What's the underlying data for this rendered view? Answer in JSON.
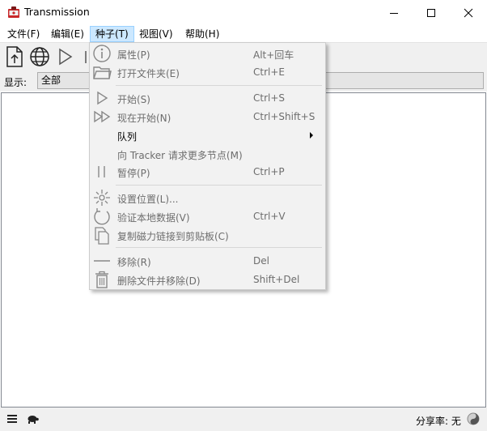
{
  "window": {
    "title": "Transmission",
    "icon": "transmission-app-icon",
    "controls": [
      "minimize-icon",
      "maximize-icon",
      "close-icon"
    ]
  },
  "menubar": {
    "items": [
      {
        "label": "文件(F)"
      },
      {
        "label": "编辑(E)"
      },
      {
        "label": "种子(T)",
        "active": true
      },
      {
        "label": "视图(V)"
      },
      {
        "label": "帮助(H)"
      }
    ]
  },
  "toolbar": {
    "buttons": [
      "open-file-icon",
      "globe-icon",
      "start-icon",
      "pause-icon"
    ]
  },
  "filter": {
    "label": "显示:",
    "selected": "全部"
  },
  "statusbar": {
    "ratio_label": "分享率: 无",
    "icons": [
      "menu-icon",
      "turtle-icon",
      "ratio-icon"
    ]
  },
  "torrent_menu": {
    "items": [
      {
        "label": "属性(P)",
        "accel": "Alt+回车",
        "icon": "info-icon",
        "enabled": false
      },
      {
        "label": "打开文件夹(E)",
        "accel": "Ctrl+E",
        "icon": "folder-icon",
        "enabled": false
      },
      {
        "label": "开始(S)",
        "accel": "Ctrl+S",
        "icon": "play-icon",
        "enabled": false
      },
      {
        "label": "现在开始(N)",
        "accel": "Ctrl+Shift+S",
        "icon": "fast-forward-icon",
        "enabled": false
      },
      {
        "label": "队列",
        "accel": "",
        "icon": "",
        "enabled": true,
        "submenu": true
      },
      {
        "label": "向 Tracker 请求更多节点(M)",
        "accel": "",
        "icon": "",
        "enabled": false
      },
      {
        "label": "暂停(P)",
        "accel": "Ctrl+P",
        "icon": "pause-icon",
        "enabled": false
      },
      {
        "label": "设置位置(L)...",
        "accel": "",
        "icon": "set-location-icon",
        "enabled": false
      },
      {
        "label": "验证本地数据(V)",
        "accel": "Ctrl+V",
        "icon": "verify-icon",
        "enabled": false
      },
      {
        "label": "复制磁力链接到剪贴板(C)",
        "accel": "",
        "icon": "copy-icon",
        "enabled": false
      },
      {
        "label": "移除(R)",
        "accel": "Del",
        "icon": "remove-icon",
        "enabled": false
      },
      {
        "label": "删除文件并移除(D)",
        "accel": "Shift+Del",
        "icon": "trash-icon",
        "enabled": false
      }
    ]
  },
  "colors": {
    "menu_highlight": "#cce8ff",
    "disabled_text": "#6d6d6d",
    "app_icon_red": "#c8282a"
  }
}
